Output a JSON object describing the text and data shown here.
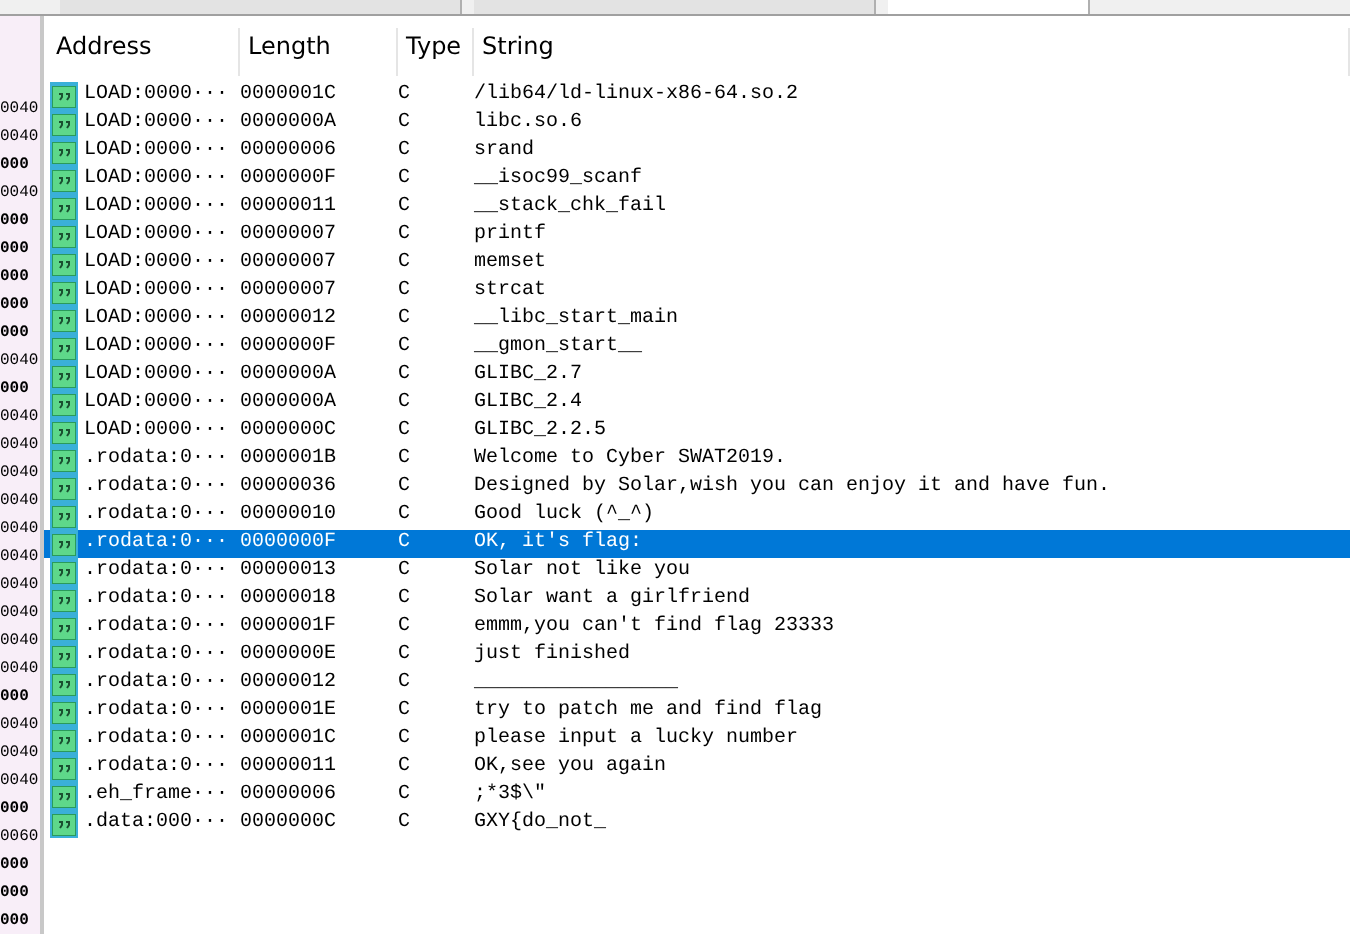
{
  "tabs": [
    {
      "selected": false
    },
    {
      "selected": false
    },
    {
      "selected": true
    }
  ],
  "left_pane": [
    {
      "text": "0040",
      "bold": false
    },
    {
      "text": "0040",
      "bold": false
    },
    {
      "text": "000",
      "bold": true
    },
    {
      "text": "0040",
      "bold": false
    },
    {
      "text": "000",
      "bold": true
    },
    {
      "text": "000",
      "bold": true
    },
    {
      "text": "000",
      "bold": true
    },
    {
      "text": "000",
      "bold": true
    },
    {
      "text": "000",
      "bold": true
    },
    {
      "text": "0040",
      "bold": false
    },
    {
      "text": "000",
      "bold": true
    },
    {
      "text": "0040",
      "bold": false
    },
    {
      "text": "0040",
      "bold": false
    },
    {
      "text": "0040",
      "bold": false
    },
    {
      "text": "0040",
      "bold": false
    },
    {
      "text": "0040",
      "bold": false
    },
    {
      "text": "0040",
      "bold": false
    },
    {
      "text": "0040",
      "bold": false
    },
    {
      "text": "0040",
      "bold": false
    },
    {
      "text": "0040",
      "bold": false
    },
    {
      "text": "0040",
      "bold": false
    },
    {
      "text": "000",
      "bold": true
    },
    {
      "text": "0040",
      "bold": false
    },
    {
      "text": "0040",
      "bold": false
    },
    {
      "text": "0040",
      "bold": false
    },
    {
      "text": "000",
      "bold": true
    },
    {
      "text": "0060",
      "bold": false
    },
    {
      "text": "000",
      "bold": true
    },
    {
      "text": "000",
      "bold": true
    },
    {
      "text": "000",
      "bold": true
    }
  ],
  "table": {
    "columns": [
      "Address",
      "Length",
      "Type",
      "String"
    ],
    "rows": [
      {
        "address": "LOAD:0000···",
        "length": "0000001C",
        "type": "C",
        "string": "/lib64/ld-linux-x86-64.so.2",
        "selected": false
      },
      {
        "address": "LOAD:0000···",
        "length": "0000000A",
        "type": "C",
        "string": "libc.so.6",
        "selected": false
      },
      {
        "address": "LOAD:0000···",
        "length": "00000006",
        "type": "C",
        "string": "srand",
        "selected": false
      },
      {
        "address": "LOAD:0000···",
        "length": "0000000F",
        "type": "C",
        "string": "__isoc99_scanf",
        "selected": false
      },
      {
        "address": "LOAD:0000···",
        "length": "00000011",
        "type": "C",
        "string": "__stack_chk_fail",
        "selected": false
      },
      {
        "address": "LOAD:0000···",
        "length": "00000007",
        "type": "C",
        "string": "printf",
        "selected": false
      },
      {
        "address": "LOAD:0000···",
        "length": "00000007",
        "type": "C",
        "string": "memset",
        "selected": false
      },
      {
        "address": "LOAD:0000···",
        "length": "00000007",
        "type": "C",
        "string": "strcat",
        "selected": false
      },
      {
        "address": "LOAD:0000···",
        "length": "00000012",
        "type": "C",
        "string": "__libc_start_main",
        "selected": false
      },
      {
        "address": "LOAD:0000···",
        "length": "0000000F",
        "type": "C",
        "string": "__gmon_start__",
        "selected": false
      },
      {
        "address": "LOAD:0000···",
        "length": "0000000A",
        "type": "C",
        "string": "GLIBC_2.7",
        "selected": false
      },
      {
        "address": "LOAD:0000···",
        "length": "0000000A",
        "type": "C",
        "string": "GLIBC_2.4",
        "selected": false
      },
      {
        "address": "LOAD:0000···",
        "length": "0000000C",
        "type": "C",
        "string": "GLIBC_2.2.5",
        "selected": false
      },
      {
        "address": ".rodata:0···",
        "length": "0000001B",
        "type": "C",
        "string": "Welcome to Cyber SWAT2019.",
        "selected": false
      },
      {
        "address": ".rodata:0···",
        "length": "00000036",
        "type": "C",
        "string": "Designed by Solar,wish you can enjoy it and have fun.",
        "selected": false
      },
      {
        "address": ".rodata:0···",
        "length": "00000010",
        "type": "C",
        "string": "Good luck (^_^)",
        "selected": false
      },
      {
        "address": ".rodata:0···",
        "length": "0000000F",
        "type": "C",
        "string": "OK, it's flag:",
        "selected": true
      },
      {
        "address": ".rodata:0···",
        "length": "00000013",
        "type": "C",
        "string": "Solar not like you",
        "selected": false
      },
      {
        "address": ".rodata:0···",
        "length": "00000018",
        "type": "C",
        "string": "Solar want a girlfriend",
        "selected": false
      },
      {
        "address": ".rodata:0···",
        "length": "0000001F",
        "type": "C",
        "string": "emmm,you can't find flag 23333",
        "selected": false
      },
      {
        "address": ".rodata:0···",
        "length": "0000000E",
        "type": "C",
        "string": "just finished",
        "selected": false
      },
      {
        "address": ".rodata:0···",
        "length": "00000012",
        "type": "C",
        "string": "_________________",
        "selected": false
      },
      {
        "address": ".rodata:0···",
        "length": "0000001E",
        "type": "C",
        "string": "try to patch me and find flag",
        "selected": false
      },
      {
        "address": ".rodata:0···",
        "length": "0000001C",
        "type": "C",
        "string": "please input a lucky number",
        "selected": false
      },
      {
        "address": ".rodata:0···",
        "length": "00000011",
        "type": "C",
        "string": "OK,see you again",
        "selected": false
      },
      {
        "address": ".eh_frame···",
        "length": "00000006",
        "type": "C",
        "string": ";*3$\\\"",
        "selected": false
      },
      {
        "address": ".data:000···",
        "length": "0000000C",
        "type": "C",
        "string": "GXY{do_not_",
        "selected": false
      }
    ]
  }
}
